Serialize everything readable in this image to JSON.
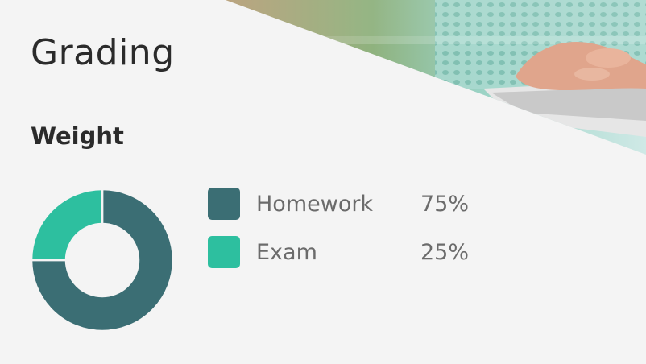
{
  "page": {
    "title": "Grading",
    "section_heading": "Weight"
  },
  "colors": {
    "background": "#f4f4f4",
    "homework": "#3b6e74",
    "exam": "#2dbf9f",
    "text_dark": "#2b2b2b",
    "text_muted": "#6b6b6b"
  },
  "hero_image": {
    "icon": "photo-hands-on-tablet"
  },
  "chart_data": {
    "type": "pie",
    "series": [
      {
        "name": "Homework",
        "value": 75,
        "label": "75%",
        "color": "#3b6e74"
      },
      {
        "name": "Exam",
        "value": 25,
        "label": "25%",
        "color": "#2dbf9f"
      }
    ]
  }
}
